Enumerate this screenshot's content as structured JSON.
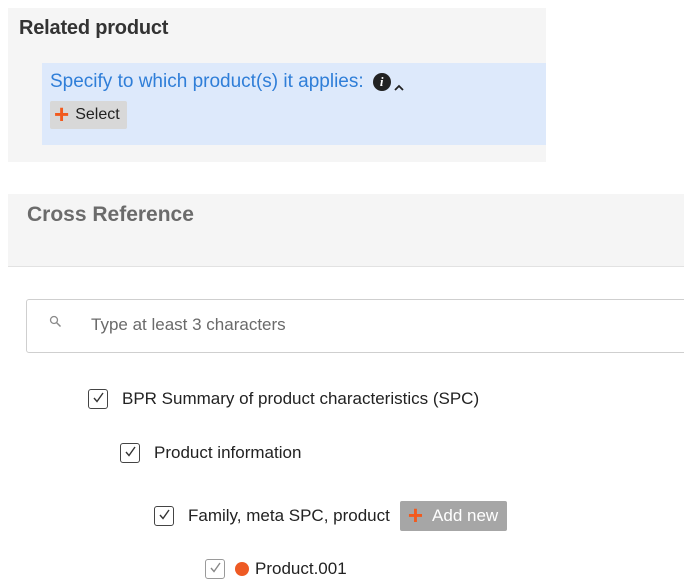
{
  "related_product": {
    "title": "Related product",
    "specify_label": "Specify to which product(s) it applies:",
    "select_label": "Select"
  },
  "cross_reference": {
    "title": "Cross Reference",
    "search": {
      "placeholder": "Type at least 3 characters",
      "value": ""
    }
  },
  "tree": [
    {
      "label": "BPR Summary of product characteristics (SPC)",
      "checked": true
    },
    {
      "label": "Product information",
      "checked": true
    },
    {
      "label": "Family, meta SPC, product",
      "checked": true,
      "add_new_label": "Add new"
    },
    {
      "label": "Product.001",
      "checked": true
    }
  ],
  "colors": {
    "accent_blue": "#2f7ed8",
    "plus_orange": "#f25a1d",
    "highlight_bg": "#dde9fb"
  },
  "icons": [
    "info-icon",
    "caret-up-icon",
    "plus-icon",
    "search-icon",
    "checkbox-checked-icon",
    "status-dot-icon"
  ]
}
